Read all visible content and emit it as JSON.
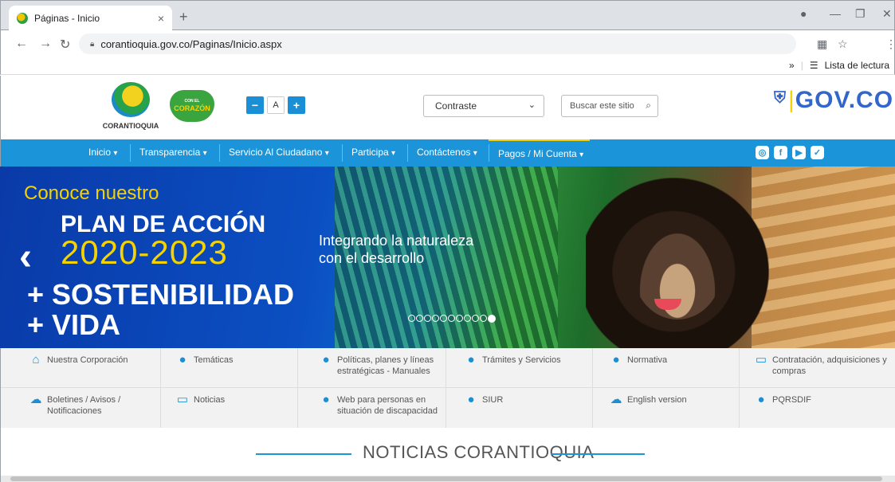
{
  "browser": {
    "tab_title": "Páginas - Inicio",
    "tab_close": "×",
    "new_tab": "+",
    "url": "corantioquia.gov.co/Paginas/Inicio.aspx",
    "reading_list_label": "Lista de lectura",
    "bookmarks_more": "»"
  },
  "header": {
    "logo_name": "CORANTIOQUIA",
    "heart_small": "CON EL",
    "heart_text": "CORAZÓN",
    "font_decrease": "−",
    "font_normal": "A",
    "font_increase": "+",
    "contrast_label": "Contraste",
    "search_placeholder": "Buscar este sitio",
    "govco": "GOV.CO"
  },
  "nav": {
    "items": [
      {
        "label": "Inicio"
      },
      {
        "label": "Transparencia"
      },
      {
        "label": "Servicio Al Ciudadano"
      },
      {
        "label": "Participa"
      },
      {
        "label": "Contáctenos"
      },
      {
        "label": "Pagos / Mi Cuenta"
      }
    ],
    "social": [
      "instagram",
      "facebook",
      "youtube",
      "twitter"
    ]
  },
  "banner": {
    "conoce": "Conoce nuestro",
    "plan": "PLAN DE ACCIÓN",
    "years": "2020-2023",
    "sostenibilidad": "+ SOSTENIBILIDAD",
    "vida": "+ VIDA",
    "integrando_1": "Integrando la naturaleza",
    "integrando_2": "con el desarrollo",
    "slide_count": 11,
    "active_slide": 11
  },
  "quicklinks": {
    "row1": [
      {
        "label": "Nuestra Corporación",
        "icon": "home-icon"
      },
      {
        "label": "Temáticas",
        "icon": "chat-user-icon"
      },
      {
        "label": "Políticas, planes y líneas estratégicas - Manuales",
        "icon": "people-icon"
      },
      {
        "label": "Trámites y Servicios",
        "icon": "user-icon"
      },
      {
        "label": "Normativa",
        "icon": "user-icon"
      },
      {
        "label": "Contratación, adquisiciones y compras",
        "icon": "laptop-icon"
      }
    ],
    "row2": [
      {
        "label": "Boletines / Avisos / Notificaciones",
        "icon": "cloud-user-icon"
      },
      {
        "label": "Noticias",
        "icon": "laptop-icon"
      },
      {
        "label": "Web para personas en situación de discapacidad",
        "icon": "chat-user-icon"
      },
      {
        "label": "SIUR",
        "icon": "chat-user-icon"
      },
      {
        "label": "English version",
        "icon": "cloud-user-icon"
      },
      {
        "label": "PQRSDIF",
        "icon": "user-icon"
      }
    ]
  },
  "news": {
    "title": "NOTICIAS CORANTIOQUIA"
  },
  "colors": {
    "brand_blue": "#1b94d9",
    "accent_yellow": "#f5d300",
    "govco_blue": "#3366cc"
  }
}
